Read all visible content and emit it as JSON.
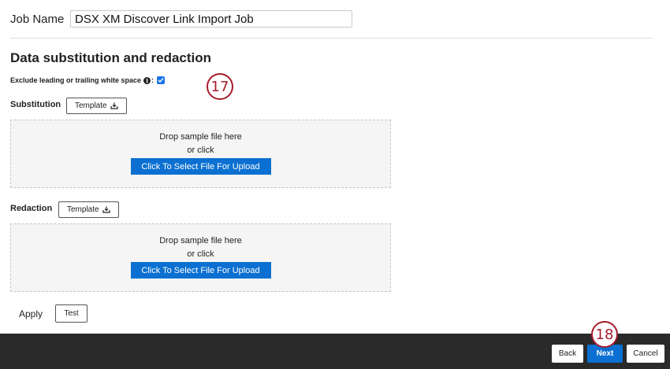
{
  "job": {
    "label": "Job Name",
    "value": "DSX XM Discover Link Import Job"
  },
  "section": {
    "title": "Data substitution and redaction",
    "whitespace_label": "Exclude leading or trailing white space",
    "whitespace_checked": true
  },
  "substitution": {
    "label": "Substitution",
    "template_label": "Template",
    "drop_text": "Drop sample file here",
    "or_text": "or click",
    "upload_label": "Click To Select File For Upload"
  },
  "redaction": {
    "label": "Redaction",
    "template_label": "Template",
    "drop_text": "Drop sample file here",
    "or_text": "or click",
    "upload_label": "Click To Select File For Upload"
  },
  "apply": {
    "label": "Apply",
    "test_label": "Test"
  },
  "callouts": {
    "first": "17",
    "second": "18"
  },
  "footer": {
    "back_label": "Back",
    "next_label": "Next",
    "cancel_label": "Cancel"
  },
  "colors": {
    "primary_blue": "#0b70d1",
    "callout_red": "#a51d2d",
    "footer_bg": "#2a2a2a"
  },
  "icons": {
    "info": "info-icon",
    "template": "download-tray-icon",
    "check": "check-icon"
  }
}
